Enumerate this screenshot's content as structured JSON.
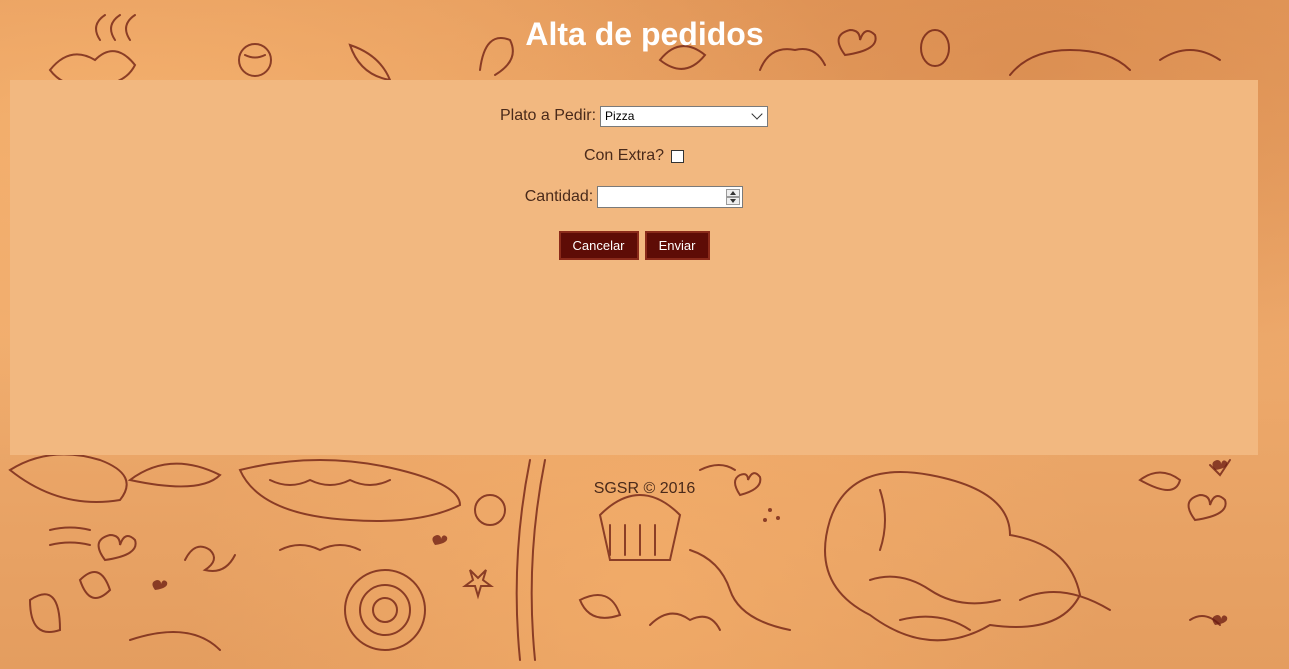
{
  "page": {
    "title": "Alta de pedidos",
    "footer": "SGSR © 2016"
  },
  "form": {
    "plato_label": "Plato a Pedir:",
    "plato_value": "Pizza",
    "extra_label": "Con Extra?",
    "extra_checked": false,
    "cantidad_label": "Cantidad:",
    "cantidad_value": "",
    "cancel_label": "Cancelar",
    "send_label": "Enviar"
  },
  "colors": {
    "background": "#e6a060",
    "panel": "#f2b880",
    "button": "#5e0c06",
    "text": "#4a2a1a",
    "doodle": "#6a1a10"
  },
  "decorations": {
    "background": "food-doodle-pattern"
  }
}
